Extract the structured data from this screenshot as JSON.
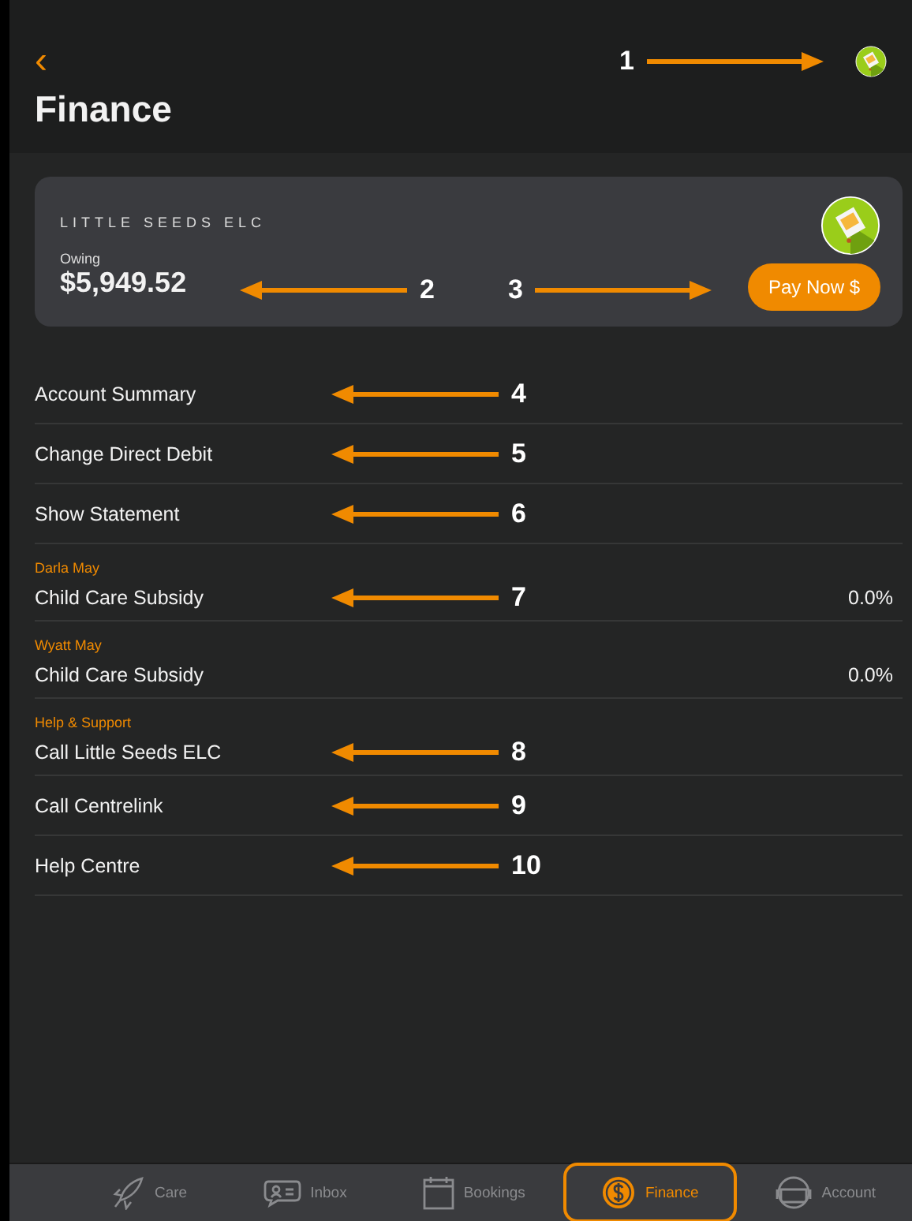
{
  "header": {
    "back": "‹",
    "title": "Finance",
    "callout": {
      "number": "1",
      "points_left": false
    }
  },
  "account_card": {
    "name": "LITTLE SEEDS ELC",
    "owing_label": "Owing",
    "amount": "$5,949.52",
    "amount_callout": {
      "number": "2",
      "points_left": true
    },
    "pay_button": "Pay Now $",
    "pay_callout": {
      "number": "3",
      "points_left": false
    }
  },
  "sections": [
    {
      "items": [
        {
          "label": "Account Summary",
          "callout": {
            "number": "4",
            "points_left": true
          }
        },
        {
          "label": "Change Direct Debit",
          "callout": {
            "number": "5",
            "points_left": true
          }
        },
        {
          "label": "Show Statement",
          "callout": {
            "number": "6",
            "points_left": true
          }
        }
      ]
    },
    {
      "heading": "Darla May",
      "items": [
        {
          "label": "Child Care Subsidy",
          "value": "0.0%",
          "callout": {
            "number": "7",
            "points_left": true
          }
        }
      ]
    },
    {
      "heading": "Wyatt May",
      "items": [
        {
          "label": "Child Care Subsidy",
          "value": "0.0%"
        }
      ]
    },
    {
      "heading": "Help & Support",
      "items": [
        {
          "label": "Call Little Seeds ELC",
          "callout": {
            "number": "8",
            "points_left": true
          }
        },
        {
          "label": "Call Centrelink",
          "callout": {
            "number": "9",
            "points_left": true
          }
        },
        {
          "label": "Help Centre",
          "callout": {
            "number": "10",
            "points_left": true
          }
        }
      ]
    }
  ],
  "tabs": [
    {
      "label": "Care",
      "kind": "rocket",
      "selected": false
    },
    {
      "label": "Inbox",
      "kind": "chat",
      "selected": false
    },
    {
      "label": "Bookings",
      "kind": "calendar",
      "selected": false
    },
    {
      "label": "Finance",
      "kind": "dollar",
      "selected": true
    },
    {
      "label": "Account",
      "kind": "helmet",
      "selected": false
    }
  ]
}
